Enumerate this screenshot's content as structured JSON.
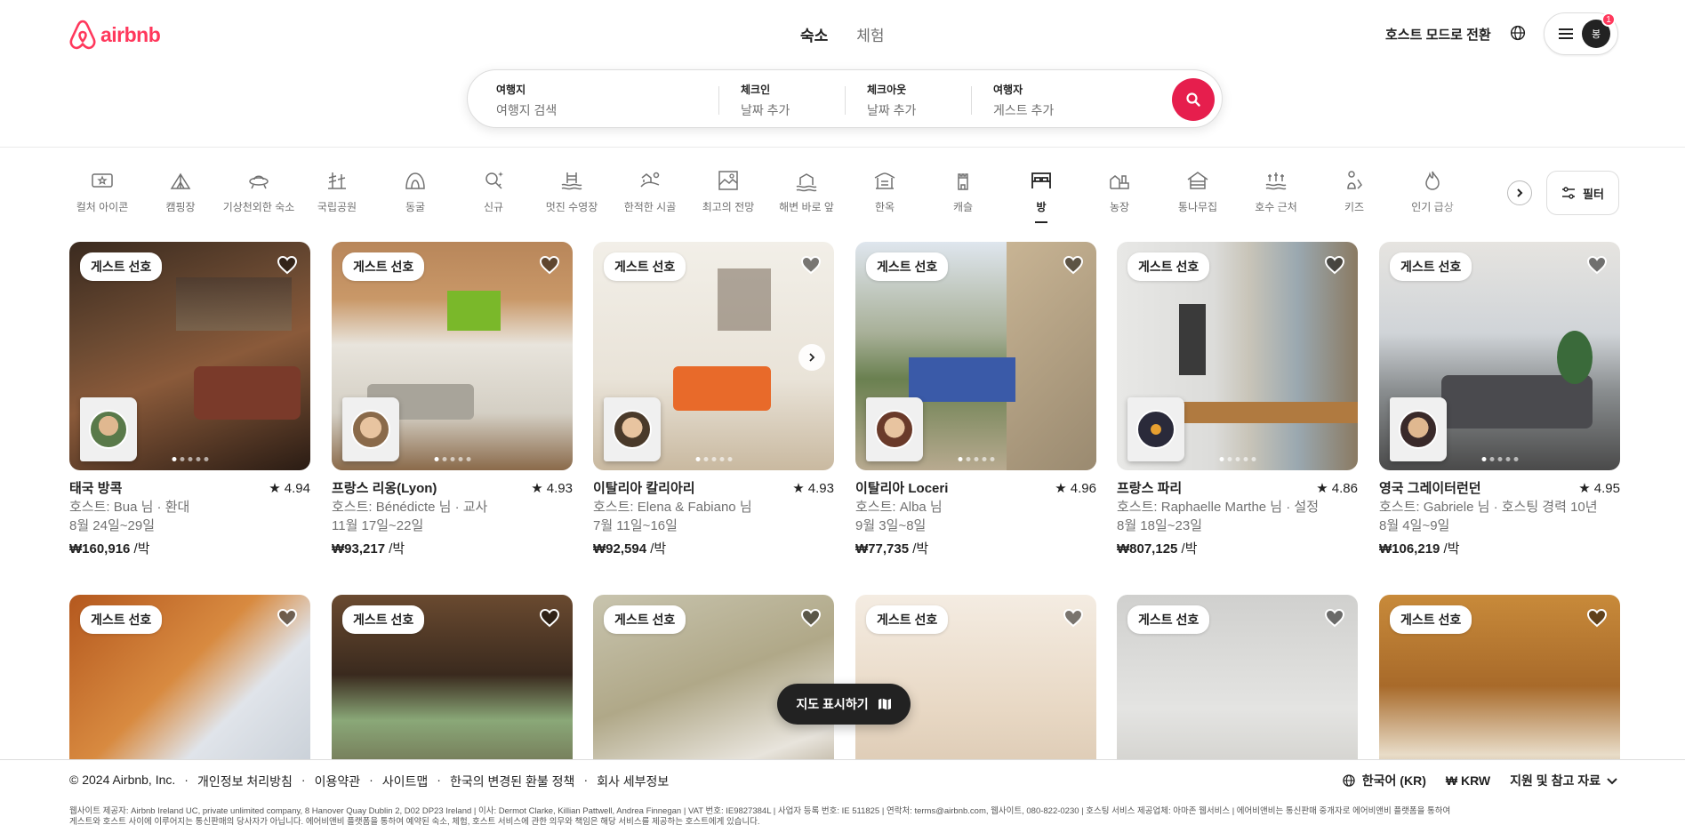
{
  "header": {
    "logo_text": "airbnb",
    "nav": [
      "숙소",
      "체험"
    ],
    "host_mode": "호스트 모드로 전환",
    "avatar_initial": "봉",
    "notification_count": "1"
  },
  "search": {
    "where_label": "여행지",
    "where_placeholder": "여행지 검색",
    "checkin_label": "체크인",
    "checkin_placeholder": "날짜 추가",
    "checkout_label": "체크아웃",
    "checkout_placeholder": "날짜 추가",
    "guests_label": "여행자",
    "guests_placeholder": "게스트 추가"
  },
  "categories": [
    {
      "label": "컬처 아이콘",
      "icon": "ticket-icon"
    },
    {
      "label": "캠핑장",
      "icon": "tent-icon"
    },
    {
      "label": "기상천외한 숙소",
      "icon": "ufo-icon"
    },
    {
      "label": "국립공원",
      "icon": "trees-icon"
    },
    {
      "label": "동굴",
      "icon": "cave-icon"
    },
    {
      "label": "신규",
      "icon": "sparkle-key-icon"
    },
    {
      "label": "멋진 수영장",
      "icon": "pool-icon"
    },
    {
      "label": "한적한 시골",
      "icon": "countryside-icon"
    },
    {
      "label": "최고의 전망",
      "icon": "view-icon"
    },
    {
      "label": "해변 바로 앞",
      "icon": "beach-icon"
    },
    {
      "label": "한옥",
      "icon": "hanok-icon"
    },
    {
      "label": "캐슬",
      "icon": "castle-icon"
    },
    {
      "label": "방",
      "icon": "room-icon"
    },
    {
      "label": "농장",
      "icon": "farm-icon"
    },
    {
      "label": "통나무집",
      "icon": "cabin-icon"
    },
    {
      "label": "호수 근처",
      "icon": "lake-icon"
    },
    {
      "label": "키즈",
      "icon": "kids-icon"
    },
    {
      "label": "인기 급상",
      "icon": "fire-icon"
    }
  ],
  "active_category": "방",
  "filter_label": "필터",
  "guest_badge": "게스트 선호",
  "listings": [
    {
      "location": "태국 방콕",
      "rating": "★ 4.94",
      "host": "호스트: Bua 님 · 환대",
      "dates": "8월 24일~29일",
      "price": "₩160,916",
      "unit": " /박"
    },
    {
      "location": "프랑스 리옹(Lyon)",
      "rating": "★ 4.93",
      "host": "호스트: Bénédicte 님 · 교사",
      "dates": "11월 17일~22일",
      "price": "₩93,217",
      "unit": " /박"
    },
    {
      "location": "이탈리아 칼리아리",
      "rating": "★ 4.93",
      "host": "호스트: Elena & Fabiano 님",
      "dates": "7월 11일~16일",
      "price": "₩92,594",
      "unit": " /박"
    },
    {
      "location": "이탈리아 Loceri",
      "rating": "★ 4.96",
      "host": "호스트: Alba 님",
      "dates": "9월 3일~8일",
      "price": "₩77,735",
      "unit": " /박"
    },
    {
      "location": "프랑스 파리",
      "rating": "★ 4.86",
      "host": "호스트: Raphaelle Marthe 님 · 설정",
      "dates": "8월 18일~23일",
      "price": "₩807,125",
      "unit": " /박"
    },
    {
      "location": "영국 그레이터런던",
      "rating": "★ 4.95",
      "host": "호스트: Gabriele 님 · 호스팅 경력 10년",
      "dates": "8월 4일~9일",
      "price": "₩106,219",
      "unit": " /박"
    }
  ],
  "map_button": "지도 표시하기",
  "footer": {
    "links": [
      "© 2024 Airbnb, Inc.",
      "개인정보 처리방침",
      "이용약관",
      "사이트맵",
      "한국의 변경된 환불 정책",
      "회사 세부정보"
    ],
    "language": "한국어 (KR)",
    "currency": "₩ KRW",
    "support": "지원 및 참고 자료",
    "legal_1": "웹사이트 제공자: Airbnb Ireland UC, private unlimited company, 8 Hanover Quay Dublin 2, D02 DP23 Ireland | 이사: Dermot Clarke, Killian Pattwell, Andrea Finnegan | VAT 번호: IE9827384L | 사업자 등록 번호: IE 511825 | 연락처: terms@airbnb.com, 웹사이트, 080-822-0230 | 호스팅 서비스 제공업체: 아마존 웹서비스 | 에어비앤비는 통신판매 중개자로 에어비앤비 플랫폼을 통하여",
    "legal_2": "게스트와 호스트 사이에 이루어지는 통신판매의 당사자가 아닙니다. 에어비앤비 플랫폼을 통하여 예약된 숙소, 체험, 호스트 서비스에 관한 의무와 책임은 해당 서비스를 제공하는 호스트에게 있습니다."
  },
  "colors": {
    "brand": "#FF385C",
    "search_button": "#E61E4D",
    "text": "#222222",
    "muted": "#717171"
  }
}
